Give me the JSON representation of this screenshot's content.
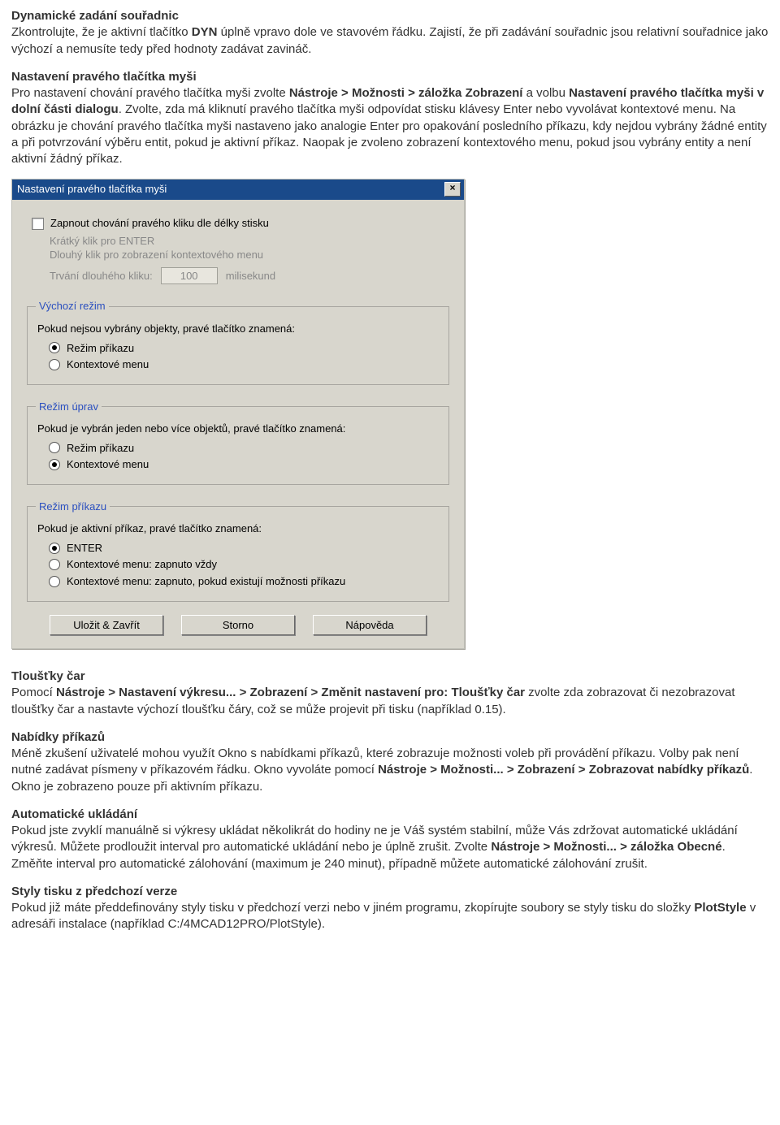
{
  "sec1": {
    "title": "Dynamické zadání souřadnic",
    "p_a": "Zkontrolujte, že je aktivní tlačítko ",
    "p_b": "DYN",
    "p_c": " úplně vpravo dole ve stavovém řádku. Zajistí, že při zadávání souřadnic jsou relativní souřadnice jako výchozí a nemusíte tedy před hodnoty zadávat zavináč."
  },
  "sec2": {
    "title": "Nastavení pravého tlačítka myši",
    "p_a": "Pro nastavení chování pravého tlačítka myši zvolte ",
    "p_b": "Nástroje > Možnosti > záložka Zobrazení",
    "p_c": " a volbu ",
    "p_d": "Nastavení pravého tlačítka myši v dolní části dialogu",
    "p_e": ". Zvolte, zda má kliknutí pravého tlačítka myši odpovídat stisku klávesy Enter nebo vyvolávat kontextové menu. Na obrázku je chování pravého tlačítka myši nastaveno jako analogie Enter pro opakování posledního příkazu, kdy nejdou vybrány žádné entity a při potvrzování výběru entit, pokud je aktivní příkaz. Naopak je zvoleno zobrazení kontextového menu, pokud jsou vybrány entity a není aktivní žádný příkaz."
  },
  "dialog": {
    "title": "Nastavení pravého tlačítka myši",
    "chk_label": "Zapnout chování pravého kliku dle délky stisku",
    "line1": "Krátký klik pro ENTER",
    "line2": "Dlouhý klik pro zobrazení kontextového menu",
    "dur_label": "Trvání dlouhého kliku:",
    "dur_value": "100",
    "dur_unit": "milisekund",
    "grp1": {
      "legend": "Výchozí režim",
      "desc": "Pokud nejsou vybrány objekty, pravé tlačítko znamená:",
      "opt1": "Režim příkazu",
      "opt2": "Kontextové menu"
    },
    "grp2": {
      "legend": "Režim úprav",
      "desc": "Pokud je vybrán jeden nebo více objektů, pravé tlačítko znamená:",
      "opt1": "Režim příkazu",
      "opt2": "Kontextové menu"
    },
    "grp3": {
      "legend": "Režim příkazu",
      "desc": "Pokud je aktivní příkaz, pravé tlačítko znamená:",
      "opt1": "ENTER",
      "opt2": "Kontextové menu: zapnuto vždy",
      "opt3": "Kontextové menu: zapnuto, pokud existují možnosti příkazu"
    },
    "btn_save": "Uložit & Zavřít",
    "btn_cancel": "Storno",
    "btn_help": "Nápověda"
  },
  "sec3": {
    "title": "Tloušťky čar",
    "p_a": "Pomocí ",
    "p_b": "Nástroje > Nastavení výkresu... > Zobrazení > Změnit nastavení pro: Tloušťky čar",
    "p_c": " zvolte zda zobrazovat či nezobrazovat tloušťky čar a nastavte výchozí tloušťku čáry, což se může projevit při tisku (například 0.15)."
  },
  "sec4": {
    "title": "Nabídky příkazů",
    "p_a": "Méně zkušení uživatelé mohou využít Okno s nabídkami příkazů, které zobrazuje možnosti voleb při provádění příkazu. Volby pak není nutné zadávat písmeny v příkazovém řádku. Okno vyvoláte pomocí ",
    "p_b": "Nástroje > Možnosti... > Zobrazení > Zobrazovat nabídky příkazů",
    "p_c": ". Okno je zobrazeno pouze při aktivním příkazu."
  },
  "sec5": {
    "title": "Automatické ukládání",
    "p_a": "Pokud jste zvyklí manuálně si výkresy ukládat několikrát do hodiny ne je Váš systém stabilní, může Vás zdržovat automatické ukládání výkresů. Můžete prodloužit interval pro automatické ukládání nebo je úplně zrušit. Zvolte ",
    "p_b": "Nástroje > Možnosti... > záložka Obecné",
    "p_c": ". Změňte interval pro automatické zálohování (maximum je 240 minut), případně můžete automatické zálohování zrušit."
  },
  "sec6": {
    "title": "Styly tisku z předchozí verze",
    "p_a": "Pokud již máte předdefinovány styly tisku v předchozí verzi nebo v jiném programu, zkopírujte soubory se styly tisku do složky ",
    "p_b": "PlotStyle",
    "p_c": " v adresáři instalace (například C:/4MCAD12PRO/PlotStyle)."
  }
}
